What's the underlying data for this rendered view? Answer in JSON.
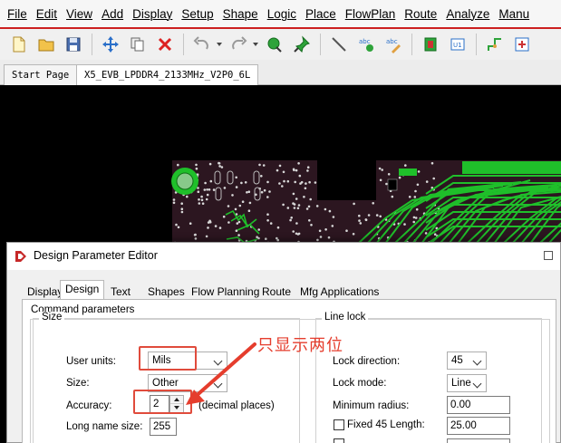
{
  "menu": [
    "File",
    "Edit",
    "View",
    "Add",
    "Display",
    "Setup",
    "Shape",
    "Logic",
    "Place",
    "FlowPlan",
    "Route",
    "Analyze",
    "Manu"
  ],
  "toolbar_icons": [
    "new-file-icon",
    "open-folder-icon",
    "save-icon",
    "move-icon",
    "copy-icon",
    "delete-icon",
    "undo-icon",
    "redo-icon",
    "pin-icon",
    "highlight-pin-icon",
    "add-line-icon",
    "add-text-icon",
    "edit-text-icon",
    "component-icon",
    "symbol-icon",
    "via-icon",
    "constraint-icon"
  ],
  "tabs": {
    "start": "Start Page",
    "design": "X5_EVB_LPDDR4_2133MHz_V2P0_6L"
  },
  "dialog": {
    "title": "Design Parameter Editor",
    "tabs": [
      "Display",
      "Design",
      "Text",
      "Shapes",
      "Flow Planning",
      "Route",
      "Mfg Applications"
    ],
    "active_tab": "Design",
    "command_parameters": "Command parameters",
    "size": {
      "title": "Size",
      "user_units_label": "User units:",
      "user_units_value": "Mils",
      "size_label": "Size:",
      "size_value": "Other",
      "accuracy_label": "Accuracy:",
      "accuracy_value": "2",
      "accuracy_suffix": "(decimal places)",
      "long_name_label": "Long name size:",
      "long_name_value": "255"
    },
    "line_lock": {
      "title": "Line lock",
      "lock_direction_label": "Lock direction:",
      "lock_direction_value": "45",
      "lock_mode_label": "Lock mode:",
      "lock_mode_value": "Line",
      "min_radius_label": "Minimum radius:",
      "min_radius_value": "0.00",
      "fixed45_label": "Fixed 45 Length:",
      "fixed45_value": "25.00",
      "fixed45_checked": false
    }
  },
  "annotation": {
    "text": "只显示两位",
    "color": "#e53d2d"
  },
  "colors": {
    "menu_accent": "#cc1f1f",
    "board": "#2c1620",
    "trace": "#1fbf2a"
  }
}
